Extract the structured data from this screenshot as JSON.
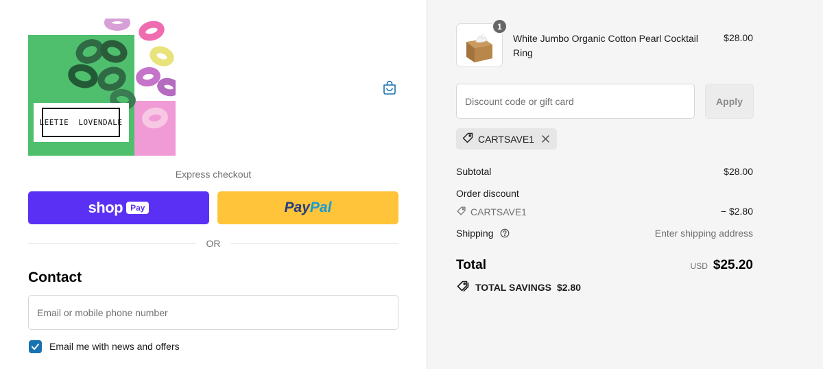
{
  "brand": {
    "logo_text": "LEETIE  LOVENDALE"
  },
  "header": {
    "cart_icon": "shopping-bag-icon"
  },
  "express": {
    "label": "Express checkout",
    "shop_word": "shop",
    "shop_pay_badge": "Pay",
    "paypal_part1": "Pay",
    "paypal_part2": "Pal",
    "divider_text": "OR"
  },
  "contact": {
    "title": "Contact",
    "email_placeholder": "Email or mobile phone number",
    "email_value": "",
    "newsletter_label": "Email me with news and offers",
    "newsletter_checked": true
  },
  "order": {
    "product": {
      "name": "White Jumbo Organic Cotton Pearl Cocktail Ring",
      "price": "$28.00",
      "quantity": "1"
    },
    "discount_placeholder": "Discount code or gift card",
    "apply_label": "Apply",
    "applied_code": "CARTSAVE1",
    "subtotal_label": "Subtotal",
    "subtotal_value": "$28.00",
    "order_discount_label": "Order discount",
    "discount_code_label": "CARTSAVE1",
    "discount_value": "− $2.80",
    "shipping_label": "Shipping",
    "shipping_value": "Enter shipping address",
    "total_label": "Total",
    "total_currency": "USD",
    "total_value": "$25.20",
    "savings_label": "TOTAL SAVINGS",
    "savings_value": "$2.80"
  },
  "colors": {
    "shop_pay": "#5a31f4",
    "paypal": "#ffc439",
    "checkbox": "#1773b0",
    "sidebar_bg": "#f5f5f5"
  }
}
